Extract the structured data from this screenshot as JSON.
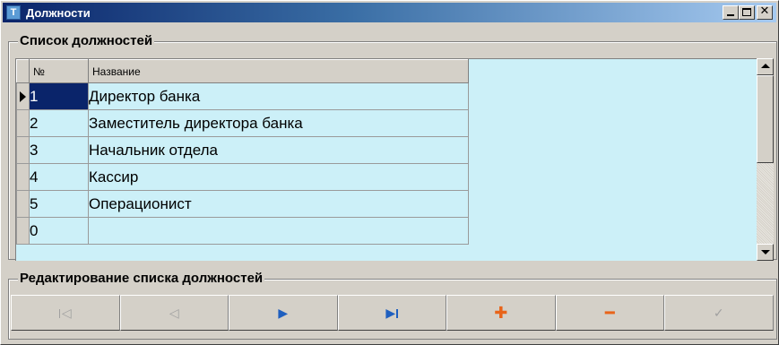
{
  "window": {
    "title": "Должности",
    "icon": "T",
    "buttons": {
      "minimize": "minimize-icon",
      "maximize": "maximize-icon",
      "close": "close-icon"
    }
  },
  "positions_group": {
    "title": "Список должностей",
    "columns": [
      "№",
      "Название"
    ],
    "rows": [
      {
        "num": "1",
        "name": "Директор банка"
      },
      {
        "num": "2",
        "name": "Заместитель директора банка"
      },
      {
        "num": "3",
        "name": "Начальник отдела"
      },
      {
        "num": "4",
        "name": "Кассир"
      },
      {
        "num": "5",
        "name": "Операционист"
      },
      {
        "num": "0",
        "name": ""
      }
    ],
    "selected_row": 0
  },
  "edit_group": {
    "title": "Редактирование списка должностей",
    "navigator": [
      {
        "icon": "first-record-icon",
        "enabled": false
      },
      {
        "icon": "prior-record-icon",
        "enabled": false
      },
      {
        "icon": "next-record-icon",
        "enabled": true
      },
      {
        "icon": "last-record-icon",
        "enabled": true
      },
      {
        "icon": "insert-record-icon",
        "enabled": true
      },
      {
        "icon": "delete-record-icon",
        "enabled": true
      },
      {
        "icon": "post-edit-icon",
        "enabled": false
      }
    ]
  },
  "colors": {
    "grid_background": "#ccf0f8",
    "selection": "#0a246a",
    "next_arrow": "#1f5fbf",
    "insert_delete": "#e8641a",
    "disabled": "#a0a0a0"
  }
}
